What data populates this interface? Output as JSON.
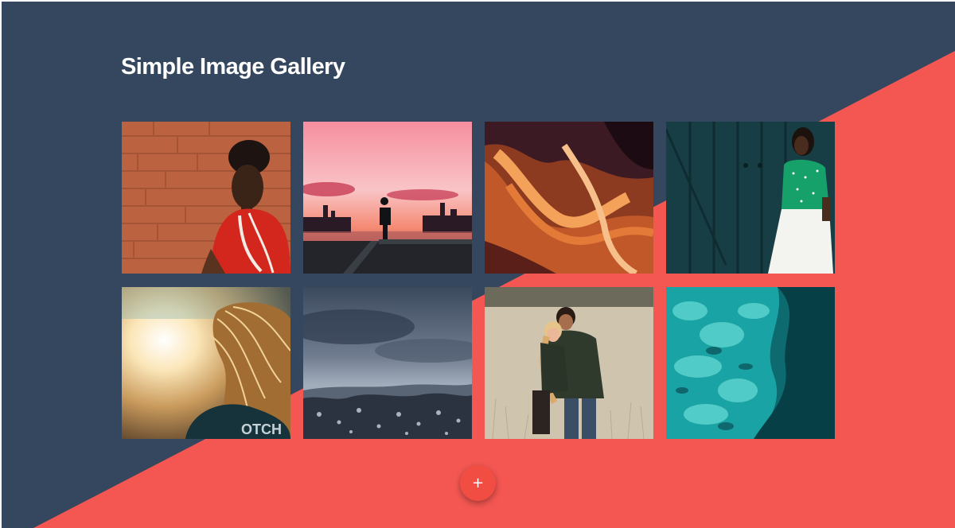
{
  "page": {
    "title": "Simple Image Gallery"
  },
  "colors": {
    "background_dark": "#34475f",
    "background_accent": "#f45752",
    "fab": "#f14d43",
    "title_text": "#ffffff"
  },
  "gallery": {
    "images": [
      {
        "subject": "woman-red-top-brick-wall"
      },
      {
        "subject": "silhouette-person-pink-sunset-city"
      },
      {
        "subject": "orange-canyon-rock-waves"
      },
      {
        "subject": "woman-green-blouse-teal-door"
      },
      {
        "subject": "blonde-hair-sunlight"
      },
      {
        "subject": "stormy-sky-snowy-forest"
      },
      {
        "subject": "couple-piggyback-field"
      },
      {
        "subject": "turquoise-water-aerial"
      }
    ]
  },
  "fab": {
    "label": "+",
    "icon": "plus-icon"
  }
}
